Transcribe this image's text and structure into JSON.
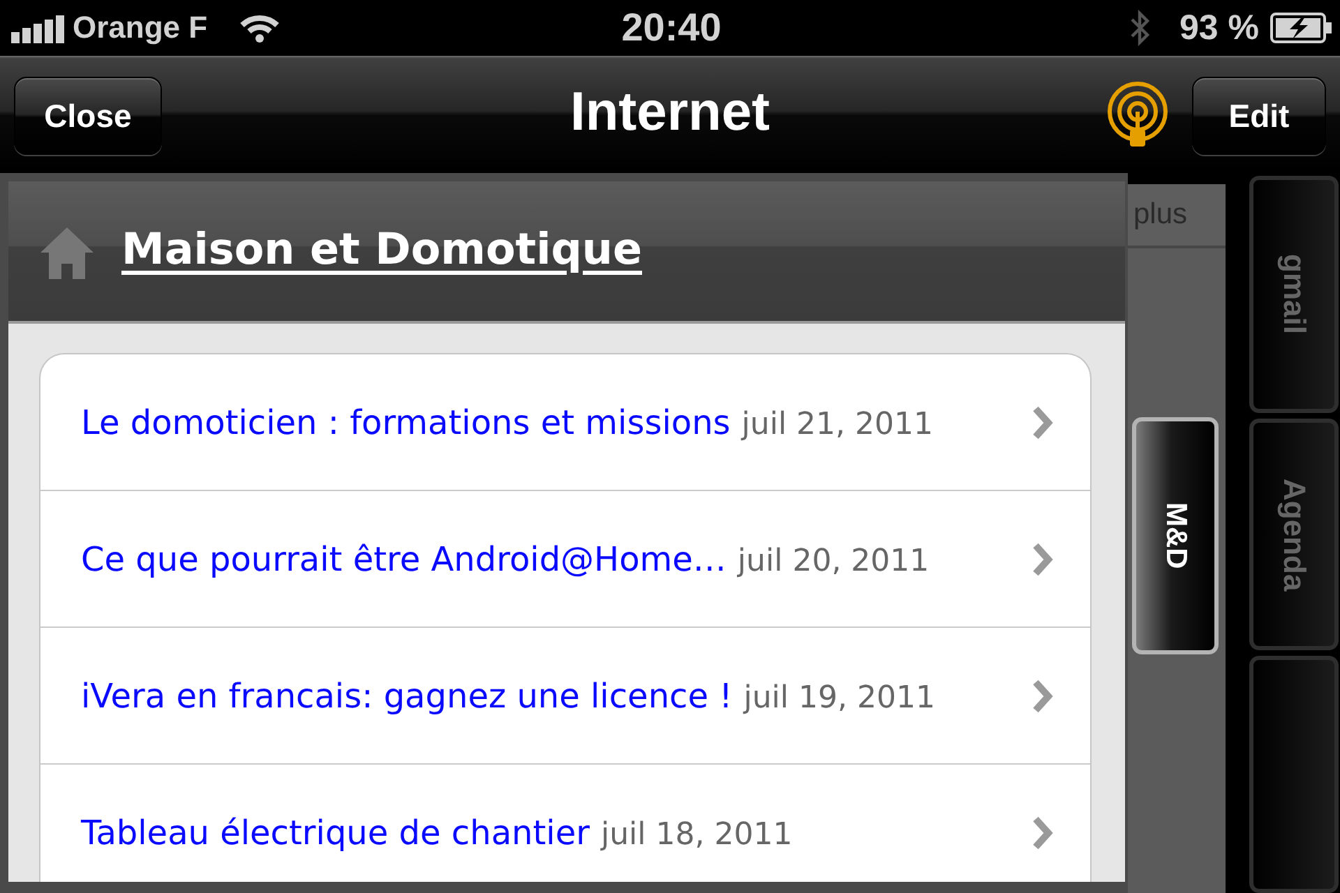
{
  "status_bar": {
    "carrier": "Orange F",
    "time": "20:40",
    "battery": "93 %"
  },
  "nav_bar": {
    "left_button": "Close",
    "title": "Internet",
    "right_button": "Edit"
  },
  "panel": {
    "title": "Maison et Domotique",
    "articles": [
      {
        "title": "Le domoticien : formations et missions",
        "date": "juil 21, 2011"
      },
      {
        "title": "Ce que pourrait être Android@Home…",
        "date": "juil 20, 2011"
      },
      {
        "title": "iVera en francais: gagnez une licence !",
        "date": "juil 19, 2011"
      },
      {
        "title": "Tableau électrique de chantier",
        "date": "juil 18, 2011"
      }
    ]
  },
  "side_tabs": {
    "more_label": "plus",
    "tabs": [
      {
        "label": "M&D",
        "selected": true
      }
    ]
  },
  "dock_tabs": [
    {
      "label": "gmail",
      "selected": false
    },
    {
      "label": "Agenda",
      "selected": false
    },
    {
      "selected": false
    }
  ]
}
